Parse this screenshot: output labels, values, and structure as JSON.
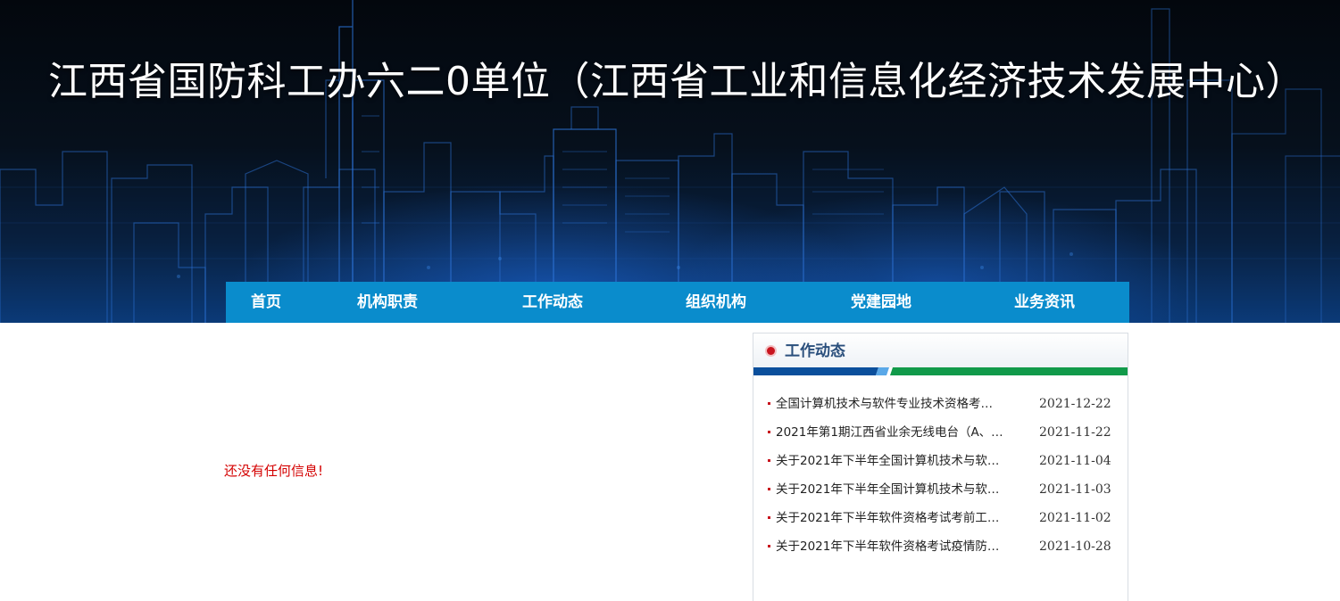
{
  "site": {
    "title": "江西省国防科工办六二0单位（江西省工业和信息化经济技术发展中心）"
  },
  "nav": {
    "items": [
      {
        "label": "首页"
      },
      {
        "label": "机构职责"
      },
      {
        "label": "工作动态"
      },
      {
        "label": "组织机构"
      },
      {
        "label": "党建园地"
      },
      {
        "label": "业务资讯"
      }
    ]
  },
  "main": {
    "empty_message": "还没有任何信息!"
  },
  "sidebar": {
    "title": "工作动态",
    "news": [
      {
        "title": "全国计算机技术与软件专业技术资格考…",
        "date": "2021-12-22"
      },
      {
        "title": "2021年第1期江西省业余无线电台（A、…",
        "date": "2021-11-22"
      },
      {
        "title": "关于2021年下半年全国计算机技术与软…",
        "date": "2021-11-04"
      },
      {
        "title": "关于2021年下半年全国计算机技术与软…",
        "date": "2021-11-03"
      },
      {
        "title": "关于2021年下半年软件资格考试考前工…",
        "date": "2021-11-02"
      },
      {
        "title": "关于2021年下半年软件资格考试疫情防…",
        "date": "2021-10-28"
      }
    ]
  },
  "colors": {
    "nav_bg": "#0a8ccc",
    "banner_bg": "#050b14",
    "accent_red": "#c8141e",
    "stripe_blue": "#0b4f9c",
    "stripe_green": "#119a4a",
    "empty_message": "#d40000"
  },
  "icons": {
    "panel_header": "circle-arrow-icon",
    "news_bullet": "square-bullet-icon"
  }
}
